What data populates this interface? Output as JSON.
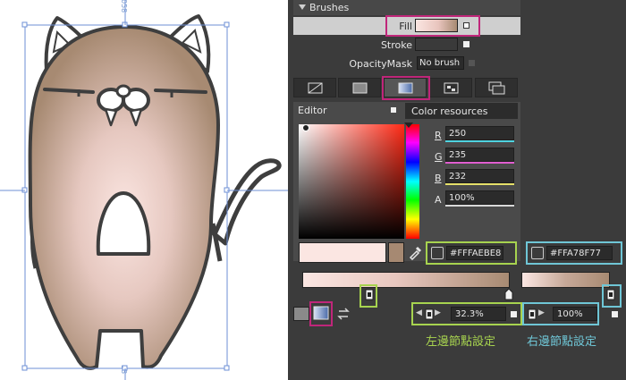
{
  "canvas": {
    "ruler_top": "058",
    "ruler_bottom": "53"
  },
  "brushes": {
    "header": "Brushes",
    "fill_label": "Fill",
    "stroke_label": "Stroke",
    "opacitymask_label": "OpacityMask",
    "opacitymask_value": "No brush"
  },
  "brush_types": [
    "no-brush-icon",
    "solid-color-icon",
    "gradient-icon",
    "tile-brush-icon",
    "brush-resources-icon"
  ],
  "editor": {
    "tab_editor": "Editor",
    "tab_color_resources": "Color resources",
    "r_label": "R",
    "r_value": "250",
    "g_label": "G",
    "g_value": "235",
    "b_label": "B",
    "b_value": "232",
    "a_label": "A",
    "a_value": "100%",
    "hex_left": "#FFFAEBE8",
    "hex_right": "#FFA78F77"
  },
  "gradient": {
    "left_offset": "32.3%",
    "right_offset": "100%",
    "left_stop_pct": 32.3,
    "right_stop_pct": 100
  },
  "notes": {
    "left": "左邊節點設定",
    "right": "右邊節點設定"
  },
  "colors": {
    "highlight_magenta": "#c0267a",
    "highlight_green": "#a7d34f",
    "highlight_cyan": "#6fc6d6",
    "fill_light": "#FAEBE8",
    "fill_dark": "#A78F77"
  }
}
